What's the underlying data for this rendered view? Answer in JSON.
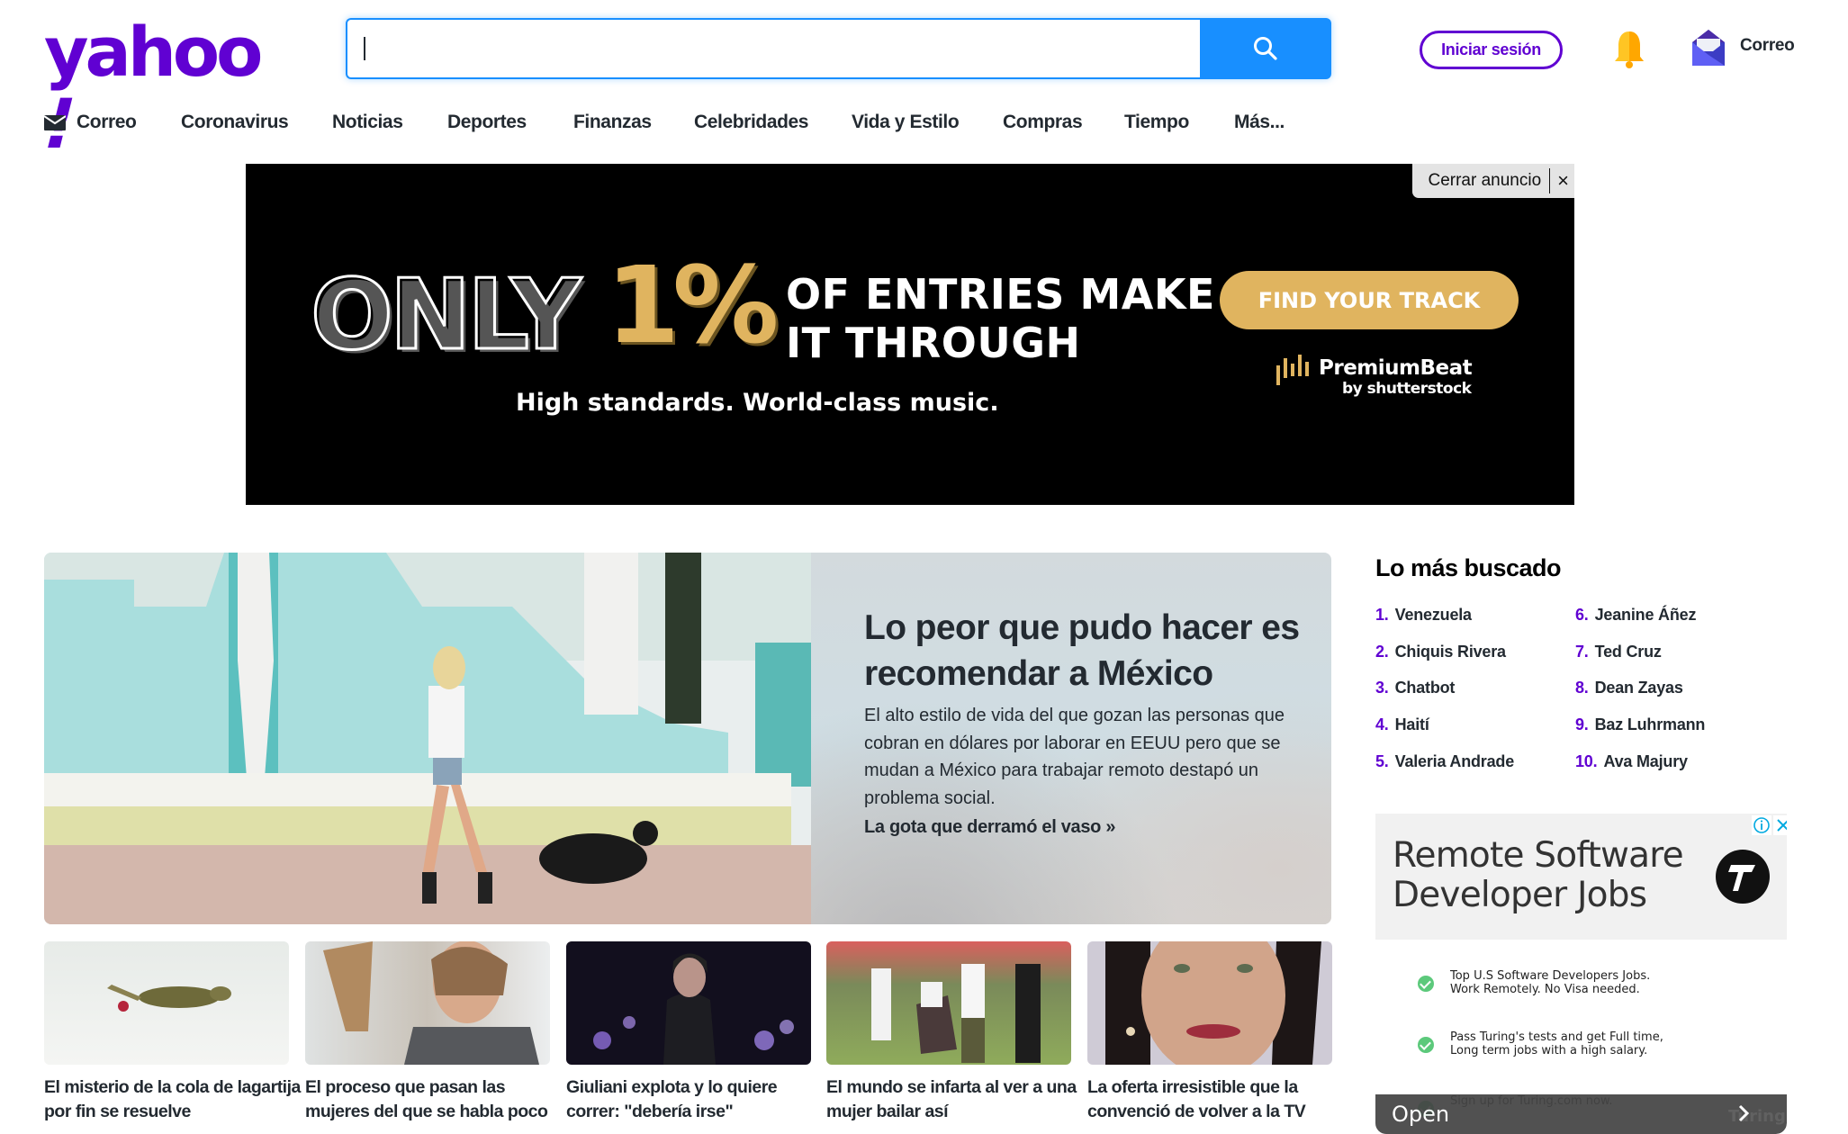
{
  "header": {
    "logo": "yahoo",
    "logo_bang": "!",
    "search": {
      "value": "",
      "placeholder": "",
      "button_icon": "search-icon"
    },
    "signin_label": "Iniciar sesión",
    "notifications_icon": "bell-icon",
    "mail_icon": "mail-icon",
    "mail_label": "Correo"
  },
  "nav": {
    "items": [
      {
        "label": "Correo",
        "icon": "envelope-icon"
      },
      {
        "label": "Coronavirus"
      },
      {
        "label": "Noticias"
      },
      {
        "label": "Deportes"
      },
      {
        "label": "Finanzas"
      },
      {
        "label": "Celebridades"
      },
      {
        "label": "Vida y Estilo"
      },
      {
        "label": "Compras"
      },
      {
        "label": "Tiempo"
      },
      {
        "label": "Más..."
      }
    ]
  },
  "ad_banner": {
    "close_label": "Cerrar anuncio",
    "close_icon": "×",
    "headline_only": "ONLY",
    "headline_pct": "1%",
    "headline_line1": "OF ENTRIES MAKE",
    "headline_line2": "IT THROUGH",
    "tagline": "High standards. World-class music.",
    "cta": "FIND YOUR TRACK",
    "brand": "PremiumBeat",
    "brand_sub": "by shutterstock",
    "accent_color": "#e0b45f"
  },
  "hero": {
    "title": "Lo peor que pudo hacer es recomendar a México",
    "summary": "El alto estilo de vida del que gozan las personas que cobran en dólares por laborar en EEUU pero que se mudan a México para trabajar remoto destapó un problema social.",
    "link": "La gota que derramó el vaso »"
  },
  "cards": [
    {
      "caption": "El misterio de la cola de lagartija por fin se resuelve"
    },
    {
      "caption": "El proceso que pasan las mujeres del que se habla poco"
    },
    {
      "caption": "Giuliani explota y lo quiere correr: \"debería irse\""
    },
    {
      "caption": "El mundo se infarta al ver a una mujer bailar así"
    },
    {
      "caption": "La oferta irresistible que la convenció de volver a la TV"
    }
  ],
  "trending": {
    "title": "Lo más buscado",
    "items": [
      {
        "num": "1.",
        "label": "Venezuela"
      },
      {
        "num": "2.",
        "label": "Chiquis Rivera"
      },
      {
        "num": "3.",
        "label": "Chatbot"
      },
      {
        "num": "4.",
        "label": "Haití"
      },
      {
        "num": "5.",
        "label": "Valeria Andrade"
      },
      {
        "num": "6.",
        "label": "Jeanine Áñez"
      },
      {
        "num": "7.",
        "label": "Ted Cruz"
      },
      {
        "num": "8.",
        "label": "Dean Zayas"
      },
      {
        "num": "9.",
        "label": "Baz Luhrmann"
      },
      {
        "num": "10.",
        "label": "Ava Majury"
      }
    ]
  },
  "side_ad": {
    "title_line1": "Remote Software",
    "title_line2": "Developer Jobs",
    "logo_glyph": "7",
    "bullets": [
      {
        "line1": "Top U.S Software Developers Jobs.",
        "line2": "Work Remotely. No Visa needed."
      },
      {
        "line1": "Pass Turing's tests and get Full time,",
        "line2": "Long term jobs with a high salary."
      },
      {
        "line1": "Sign up for Turing.com now.",
        "line2": ""
      }
    ],
    "open_label": "Open",
    "brand": "Turing",
    "info_icon": "info-icon",
    "close_icon": "close-icon"
  },
  "colors": {
    "brand_purple": "#6001d2",
    "search_blue": "#188fff",
    "text_dark": "#232a31"
  }
}
